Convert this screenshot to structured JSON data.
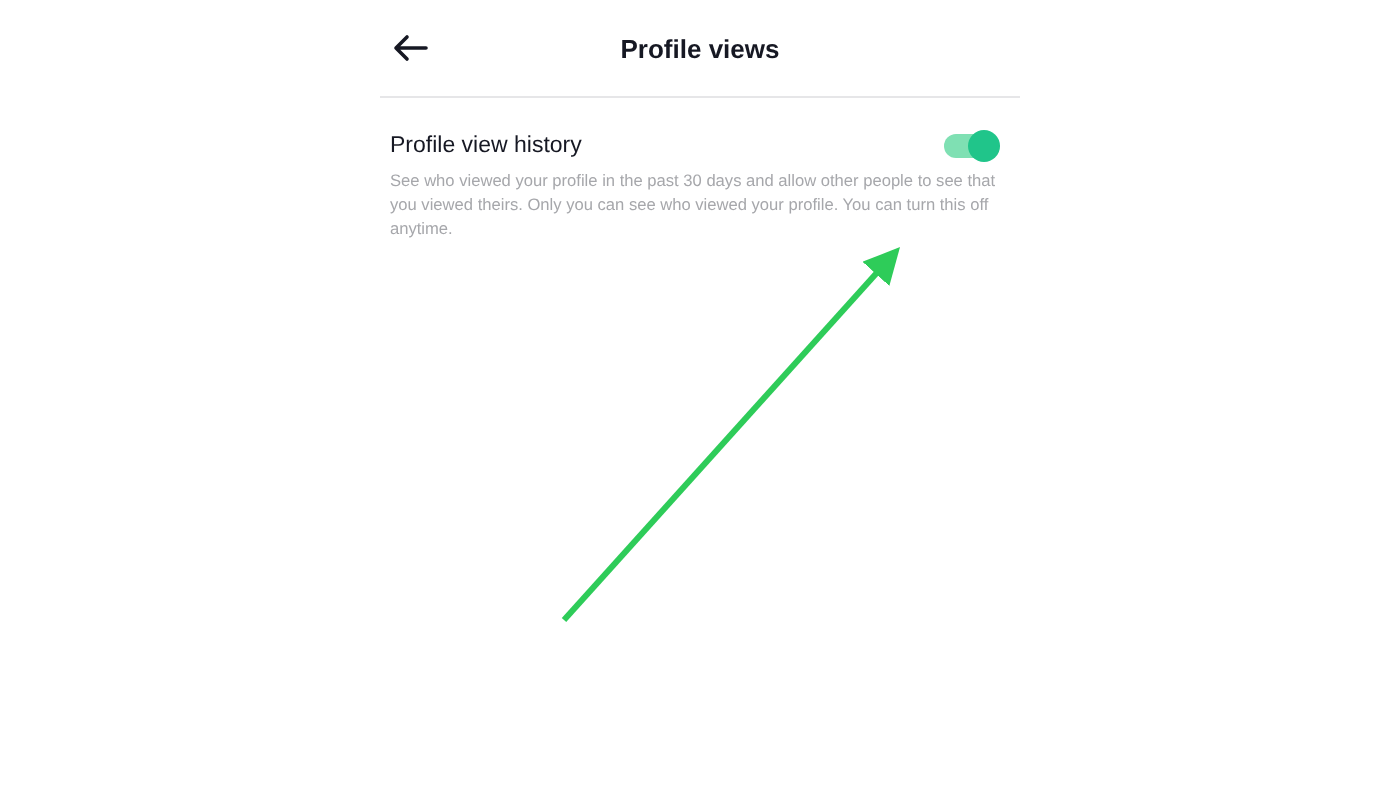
{
  "header": {
    "title": "Profile views"
  },
  "setting": {
    "label": "Profile view history",
    "on": true,
    "description": "See who viewed your profile in the past 30 days and allow other people to see that you viewed theirs. Only you can see who viewed your profile. You can turn this off anytime."
  }
}
